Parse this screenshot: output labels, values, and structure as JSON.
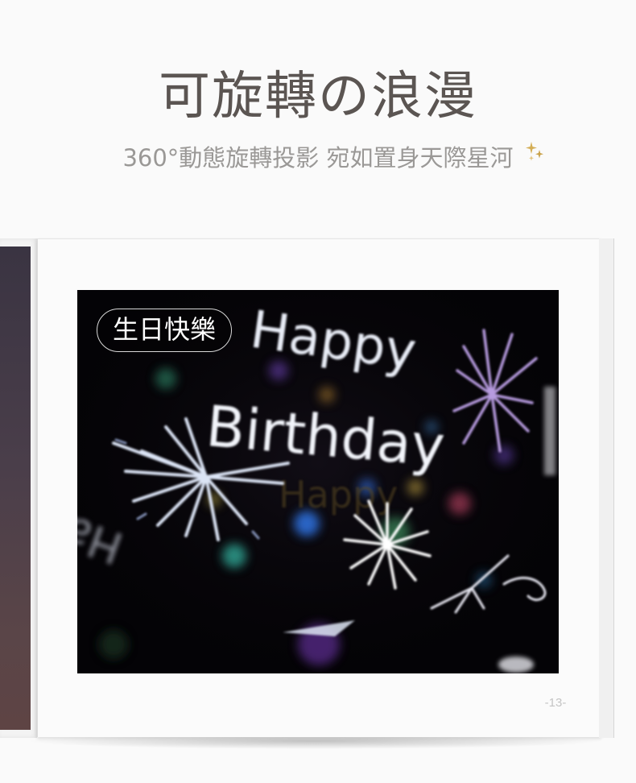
{
  "header": {
    "title": "可旋轉の浪漫",
    "subtitle": "360°動態旋轉投影  宛如置身天際星河"
  },
  "photo": {
    "badge_label": "生日快樂",
    "projection_text_line1": "Happy",
    "projection_text_line2": "Birthday",
    "ghost_text": "Happy"
  },
  "page": {
    "number_label": "-13-"
  },
  "colors": {
    "title": "#5b5552",
    "subtitle": "#9a9896",
    "photo_background": "#040306",
    "sparkle": "#c9a24a"
  },
  "icons": {
    "sparkle": "sparkle-stars-icon"
  }
}
